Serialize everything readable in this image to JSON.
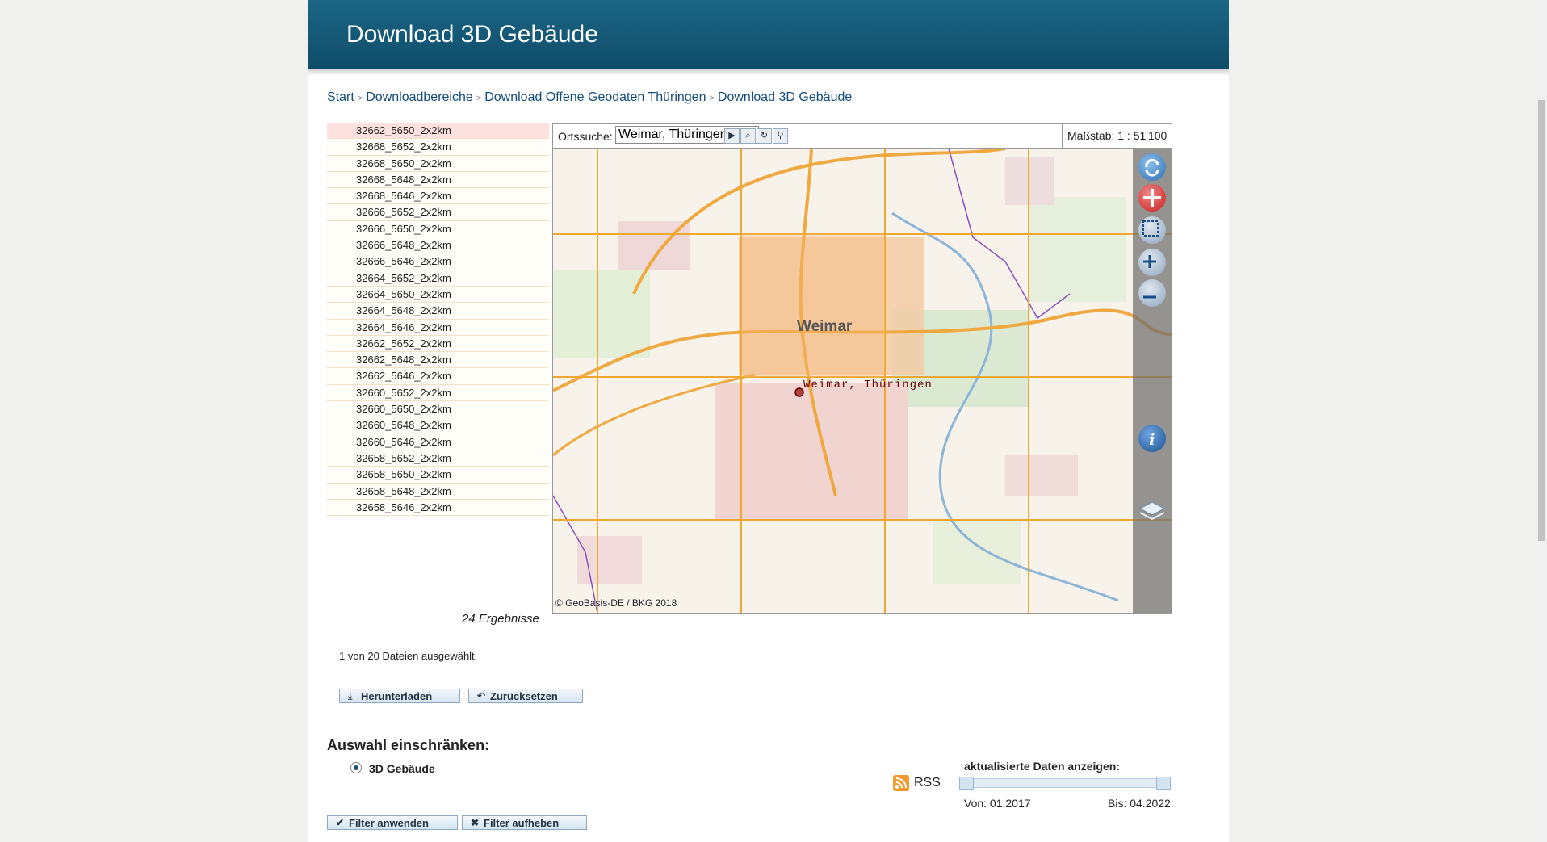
{
  "header": {
    "title": "Download 3D Gebäude"
  },
  "breadcrumb": {
    "items": [
      "Start",
      "Downloadbereiche",
      "Download Offene Geodaten Thüringen",
      "Download 3D Gebäude"
    ],
    "separator": ">"
  },
  "tiles": {
    "items": [
      "32662_5650_2x2km",
      "32668_5652_2x2km",
      "32668_5650_2x2km",
      "32668_5648_2x2km",
      "32668_5646_2x2km",
      "32666_5652_2x2km",
      "32666_5650_2x2km",
      "32666_5648_2x2km",
      "32666_5646_2x2km",
      "32664_5652_2x2km",
      "32664_5650_2x2km",
      "32664_5648_2x2km",
      "32664_5646_2x2km",
      "32662_5652_2x2km",
      "32662_5648_2x2km",
      "32662_5646_2x2km",
      "32660_5652_2x2km",
      "32660_5650_2x2km",
      "32660_5648_2x2km",
      "32660_5646_2x2km",
      "32658_5652_2x2km",
      "32658_5650_2x2km",
      "32658_5648_2x2km",
      "32658_5646_2x2km"
    ],
    "selected_index": 0,
    "results_count": "24 Ergebnisse"
  },
  "map": {
    "search_label": "Ortssuche:",
    "search_value": "Weimar, Thüringen",
    "scale_label": "Maßstab:",
    "scale_value": "1 : 51'100",
    "city_name": "Weimar",
    "marker_label": "Weimar, Thüringen",
    "copyright": "© GeoBasis-DE / BKG 2018",
    "tool_icons": [
      "play-icon",
      "zoom-to-icon",
      "reset-icon",
      "pin-icon"
    ],
    "control_icons": [
      "refresh-icon",
      "pan-icon",
      "zoom-box-icon",
      "zoom-in-icon",
      "zoom-out-icon",
      "info-icon",
      "layers-icon"
    ]
  },
  "selection": {
    "status": "1 von 20 Dateien ausgewählt.",
    "download_label": "Herunterladen",
    "reset_label": "Zurücksetzen"
  },
  "filter": {
    "heading": "Auswahl einschränken:",
    "option_label": "3D Gebäude",
    "rss_label": "RSS",
    "date_label": "aktualisierte Daten anzeigen:",
    "from_label": "Von: 01.2017",
    "to_label": "Bis: 04.2022",
    "apply_label": "Filter anwenden",
    "clear_label": "Filter aufheben"
  },
  "colors": {
    "header": "#145a78",
    "link": "#124c7a",
    "grid_line": "#f0a830",
    "selected_row": "#fde0e0"
  }
}
